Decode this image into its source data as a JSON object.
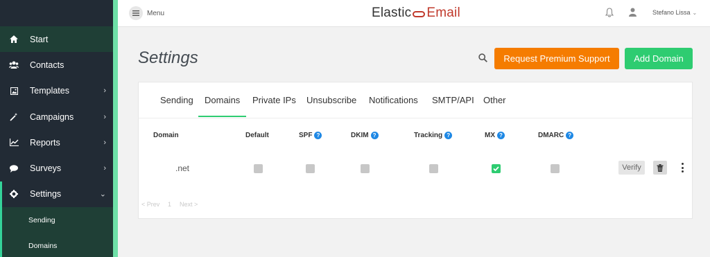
{
  "app": {
    "logo_left": "Elastic",
    "logo_right": "Email",
    "menu_label": "Menu",
    "user_name": "Stefano Lissa",
    "brand_accent": "#2ecc71",
    "brand_red": "#c0392b"
  },
  "sidebar": {
    "items": [
      {
        "label": "Start",
        "icon": "home-icon"
      },
      {
        "label": "Contacts",
        "icon": "users-icon"
      },
      {
        "label": "Templates",
        "icon": "image-icon"
      },
      {
        "label": "Campaigns",
        "icon": "magic-wand-icon"
      },
      {
        "label": "Reports",
        "icon": "line-chart-icon"
      },
      {
        "label": "Surveys",
        "icon": "chat-bubble-icon"
      },
      {
        "label": "Settings",
        "icon": "gear-icon"
      }
    ],
    "sub_items": [
      {
        "label": "Sending"
      },
      {
        "label": "Domains"
      }
    ]
  },
  "page": {
    "title": "Settings",
    "premium_label": "Request Premium Support",
    "add_domain_label": "Add Domain",
    "premium_color": "#f57c00",
    "add_color": "#2ecc71"
  },
  "tabs": [
    "Sending",
    "Domains",
    "Private IPs",
    "Unsubscribe",
    "Notifications",
    "SMTP/API",
    "Other"
  ],
  "active_tab": "Domains",
  "table": {
    "columns": [
      "Domain",
      "Default",
      "SPF",
      "DKIM",
      "Tracking",
      "MX",
      "DMARC"
    ],
    "rows": [
      {
        "domain": ".net",
        "default": false,
        "spf": false,
        "dkim": false,
        "tracking": false,
        "mx": true,
        "dmarc": false,
        "verify_label": "Verify"
      }
    ]
  },
  "pagination": {
    "prev": "< Prev",
    "page": "1",
    "next": "Next >"
  }
}
